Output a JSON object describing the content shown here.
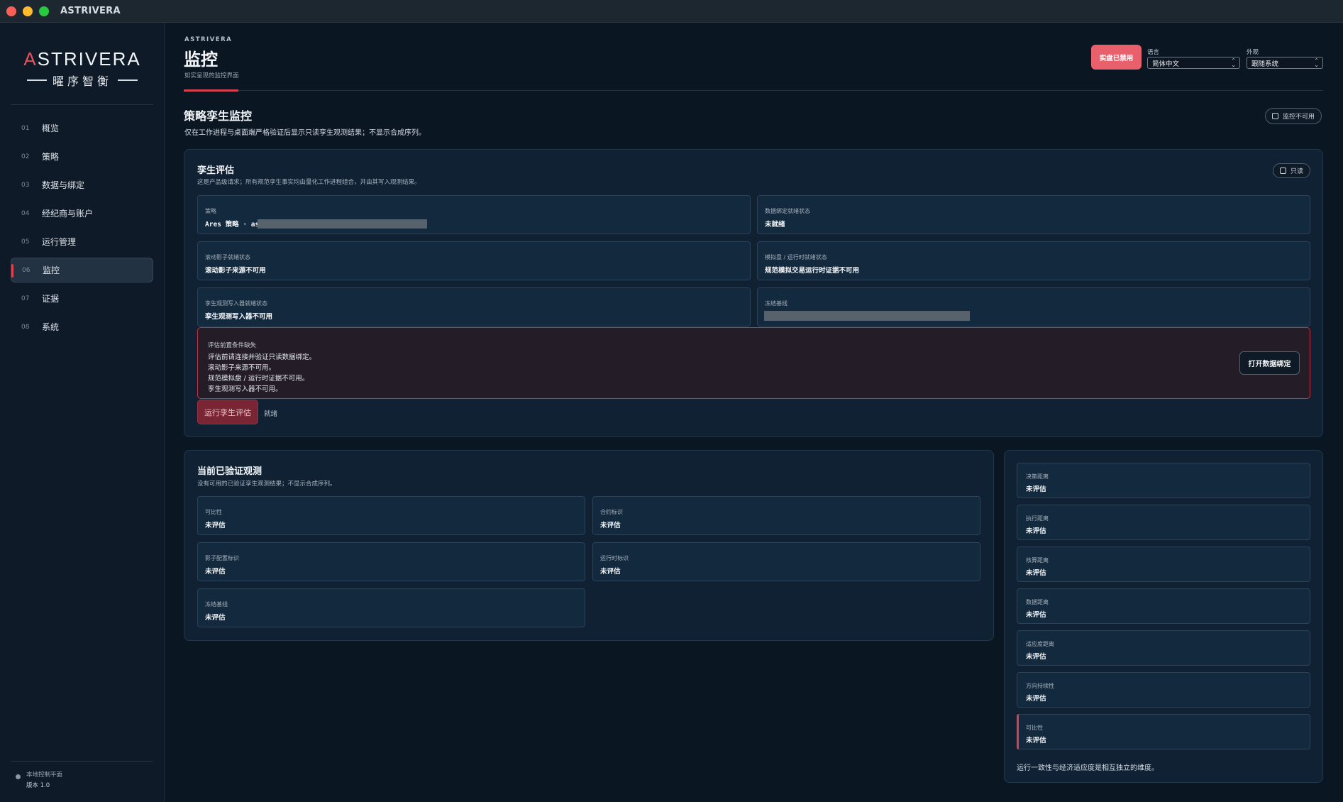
{
  "window": {
    "title": "ASTRIVERA"
  },
  "sidebar": {
    "logo_main_prefix": "A",
    "logo_main_rest": "STRIVERA",
    "logo_sub": "曜序智衡",
    "items": [
      {
        "num": "01",
        "label": "概览"
      },
      {
        "num": "02",
        "label": "策略"
      },
      {
        "num": "03",
        "label": "数据与绑定"
      },
      {
        "num": "04",
        "label": "经纪商与账户"
      },
      {
        "num": "05",
        "label": "运行管理"
      },
      {
        "num": "06",
        "label": "监控",
        "active": true
      },
      {
        "num": "07",
        "label": "证据"
      },
      {
        "num": "08",
        "label": "系统"
      }
    ],
    "footer": {
      "line1": "本地控制平面",
      "line2": "版本 1.0"
    }
  },
  "header": {
    "brand": "ASTRIVERA",
    "title": "监控",
    "subtitle": "如实呈现的监控界面",
    "live_button": "实盘已禁用",
    "language_label": "语言",
    "language_value": "简体中文",
    "appearance_label": "外观",
    "appearance_value": "跟随系统"
  },
  "section": {
    "title": "策略孪生监控",
    "description": "仅在工作进程与桌面端严格验证后显示只读孪生观测结果；不显示合成序列。",
    "status_pill": "监控不可用"
  },
  "twin_eval": {
    "title": "孪生评估",
    "description": "这是产品级请求；所有规范孪生事实均由量化工作进程组合，并由其写入观测结果。",
    "readonly_pill": "只读",
    "fields": {
      "strategy": {
        "label": "策略",
        "value": "Ares 策略 · as"
      },
      "data_binding": {
        "label": "数据绑定就绪状态",
        "value": "未就绪"
      },
      "rolling_shadow": {
        "label": "滚动影子就绪状态",
        "value": "滚动影子来源不可用"
      },
      "paper_runtime": {
        "label": "模拟盘 / 运行时就绪状态",
        "value": "规范模拟交易运行时证据不可用"
      },
      "writer": {
        "label": "孪生观测写入器就绪状态",
        "value": "孪生观测写入器不可用"
      },
      "frozen_baseline": {
        "label": "冻结基线",
        "value": ""
      }
    },
    "warning": {
      "title": "评估前置条件缺失",
      "lines": [
        "评估前请连接并验证只读数据绑定。",
        "滚动影子来源不可用。",
        "规范模拟盘 / 运行时证据不可用。",
        "孪生观测写入器不可用。"
      ],
      "button": "打开数据绑定"
    },
    "run_button": "运行孪生评估",
    "status": "就绪"
  },
  "observations": {
    "title": "当前已验证观测",
    "description": "没有可用的已验证孪生观测结果；不显示合成序列。",
    "fields": [
      {
        "label": "可比性",
        "value": "未评估"
      },
      {
        "label": "合约标识",
        "value": "未评估"
      },
      {
        "label": "影子配置标识",
        "value": "未评估"
      },
      {
        "label": "运行时标识",
        "value": "未评估"
      },
      {
        "label": "冻结基线",
        "value": "未评估"
      }
    ]
  },
  "distances": {
    "fields": [
      {
        "label": "决策距离",
        "value": "未评估"
      },
      {
        "label": "执行距离",
        "value": "未评估"
      },
      {
        "label": "核算距离",
        "value": "未评估"
      },
      {
        "label": "数据距离",
        "value": "未评估"
      },
      {
        "label": "适应度距离",
        "value": "未评估"
      },
      {
        "label": "方向持续性",
        "value": "未评估"
      },
      {
        "label": "可比性",
        "value": "未评估",
        "flagged": true
      }
    ],
    "note": "运行一致性与经济适应度是相互独立的维度。"
  },
  "colors": {
    "background": "#0b1623",
    "panel": "#0f2133",
    "accent_red": "#d8404f",
    "live_button": "#e8606b",
    "run_button": "#7a2533"
  }
}
